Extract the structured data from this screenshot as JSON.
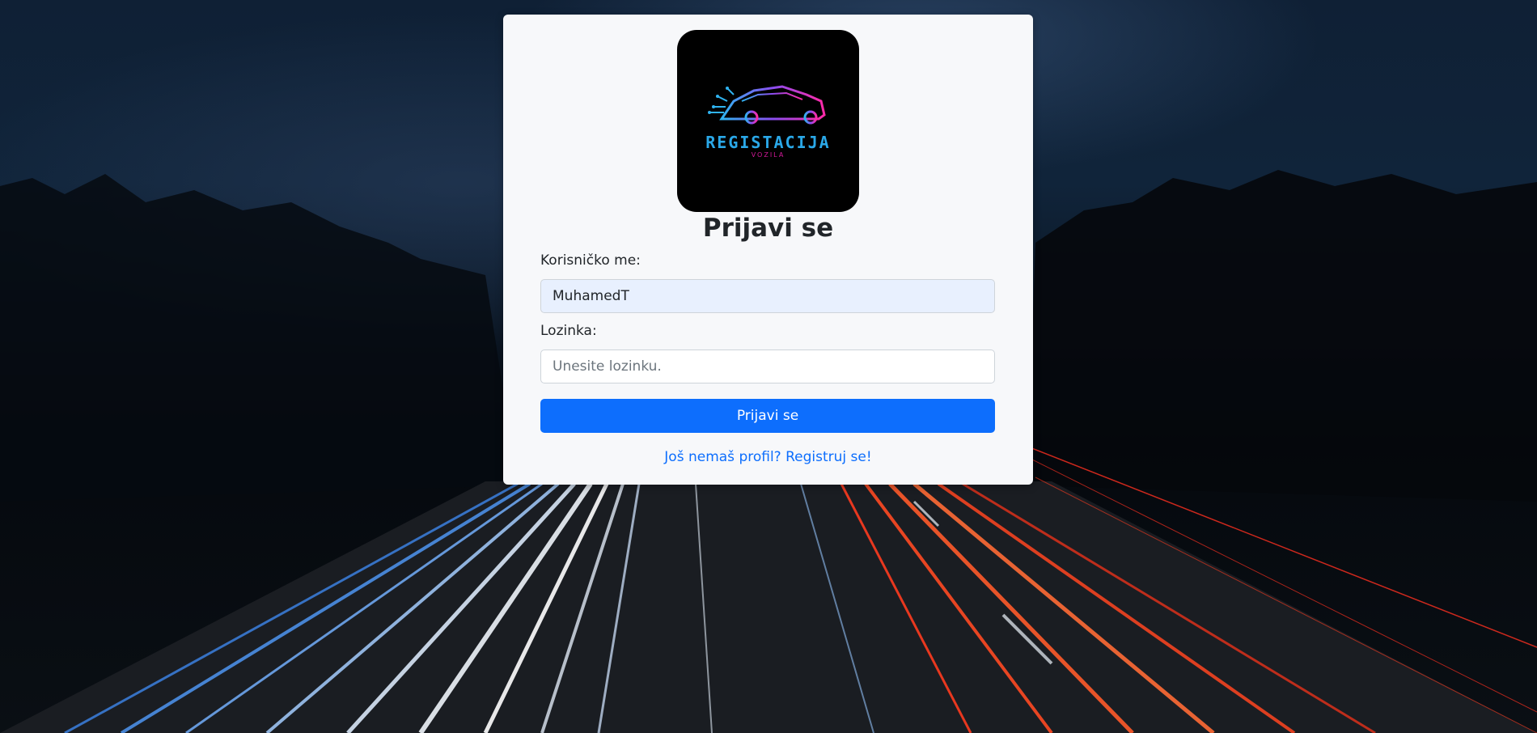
{
  "page": {
    "title": "Prijavi se"
  },
  "logo": {
    "name": "registacija-vozila-logo",
    "text": "REGISTACIJA",
    "subtext": "VOZILA",
    "text_color": "#2aa8e8",
    "accent_color": "#d41a9a"
  },
  "form": {
    "username": {
      "label": "Korisničko me:",
      "value": "MuhamedT",
      "placeholder": ""
    },
    "password": {
      "label": "Lozinka:",
      "value": "",
      "placeholder": "Unesite lozinku."
    },
    "submit_label": "Prijavi se",
    "register_link": "Još nemaš profil? Registruj se!"
  },
  "colors": {
    "primary": "#0d6efd",
    "card_background": "#f7f8fa",
    "autofill_background": "#e8f0fe"
  },
  "icons": {
    "logo_icon": "sports-car-circuit-icon"
  }
}
